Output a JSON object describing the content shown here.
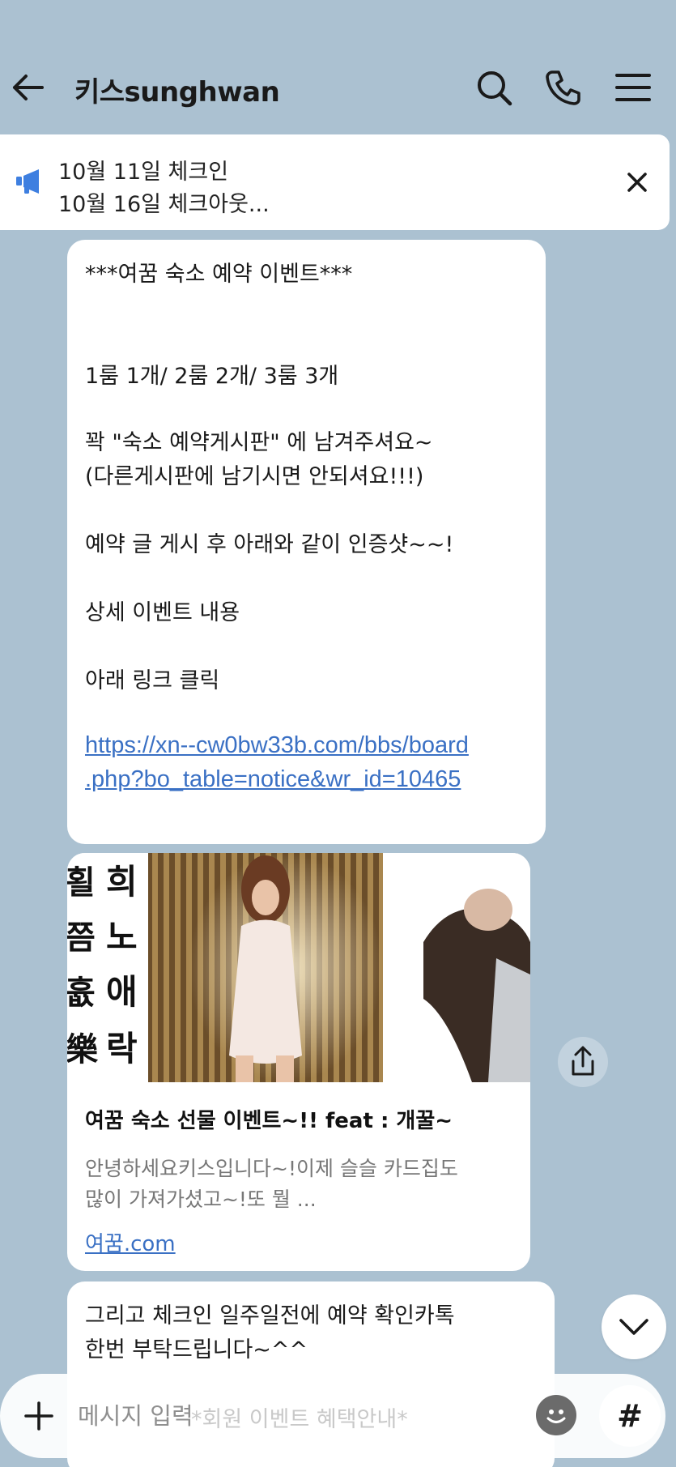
{
  "header": {
    "title": "키스sunghwan"
  },
  "notice": {
    "line1": "10월 11일 체크인",
    "line2": "10월 16일 체크아웃..."
  },
  "messages": {
    "m1": {
      "lines": [
        "***여꿈 숙소 예약 이벤트***",
        "1룸 1개/ 2룸 2개/ 3룸 3개",
        "꽉  \"숙소 예약게시판\" 에 남겨주셔요~",
        "(다른게시판에 남기시면 안되셔요!!!)",
        "예약 글 게시 후 아래와 같이 인증샷~~!",
        "상세 이벤트 내용",
        "아래 링크 클릭"
      ],
      "link_line1": "https://xn--cw0bw33b.com/bbs/board",
      "link_line2": ".php?bo_table=notice&wr_id=10465"
    },
    "m2": {
      "image_chars": [
        "희",
        "노",
        "애",
        "락"
      ],
      "title": "여꿈 숙소 선물 이벤트~!! feat : 개꿀~",
      "desc1": "안녕하세요키스입니다~!이제 슬슬 카드집도",
      "desc2": "많이 가져가셨고~!또 뭘 ...",
      "link": "여꿈.com"
    },
    "m3": {
      "line1": "그리고 체크인 일주일전에 예약 확인카톡",
      "line2": "한번 부탁드립니다~^^",
      "partial": "*회원 이벤트 혜택안내*"
    }
  },
  "input": {
    "placeholder": "메시지 입력",
    "hash_label": "#"
  }
}
